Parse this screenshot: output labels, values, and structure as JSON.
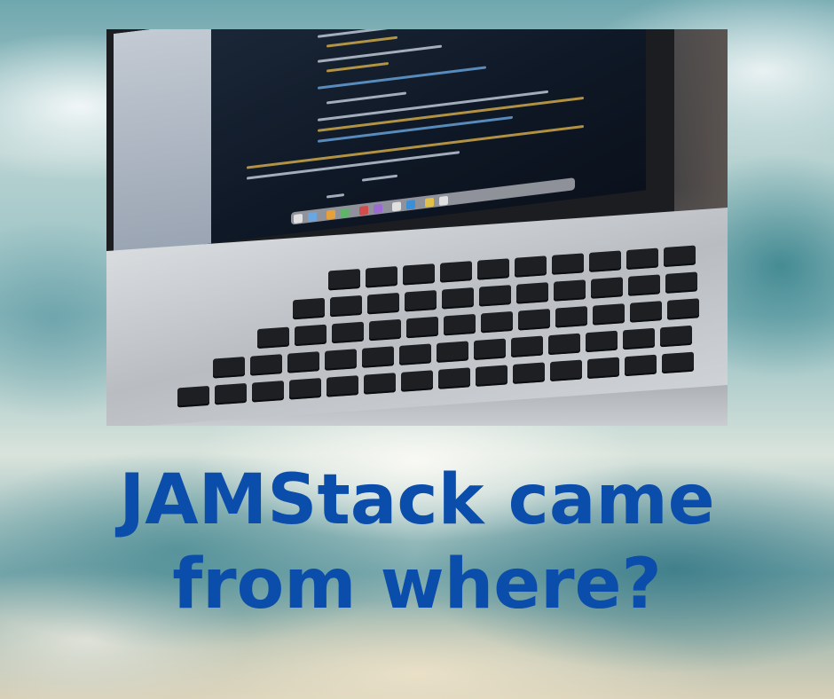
{
  "headline": {
    "line1": "JAMStack came",
    "line2": "from where?",
    "color": "#0b4dab"
  },
  "photo": {
    "subject-icon": "laptop-with-code-icon"
  },
  "palette": {
    "sky_teal": "#6fa7ae",
    "cloud_white": "#f5f5f0",
    "laptop_dark": "#1b1d21"
  }
}
